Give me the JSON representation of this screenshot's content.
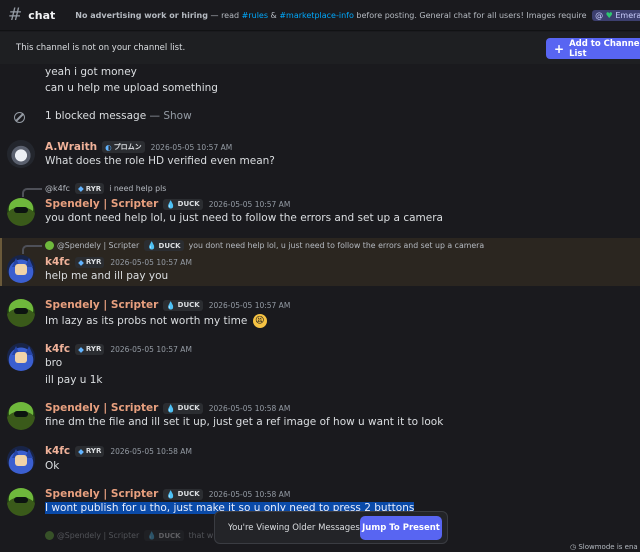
{
  "header": {
    "channel_name": "chat",
    "topic_part1": "No advertising work or hiring",
    "topic_part2": " — read ",
    "topic_rules": "#rules",
    "topic_amp": " & ",
    "topic_marketplace": "#marketplace-info",
    "topic_part3": " before posting. General chat for all users! Images require ",
    "topic_role": "@",
    "topic_role_name": "Emerald III",
    "topic_tail": "+"
  },
  "notice": {
    "text": "This channel is not on your channel list.",
    "add_button": "Add to Channel List"
  },
  "messages": {
    "m0": {
      "line1": "yeah i got money",
      "line2": "can u help me upload something"
    },
    "blocked": {
      "text": "1 blocked message",
      "dash": " — ",
      "show": "Show"
    },
    "m1": {
      "author": "A.Wraith",
      "tag": "プロムン",
      "ts": "2026-05-05 10:57 AM",
      "text": "What does the role HD verified even mean?"
    },
    "m2": {
      "reply_name": "@k4fc",
      "reply_tag": "RYR",
      "reply_text": "i need help pls",
      "author": "Spendely | Scripter",
      "tag": "DUCK",
      "ts": "2026-05-05 10:57 AM",
      "text": "you dont need help lol, u just need to follow the errors and set up a camera"
    },
    "m3": {
      "reply_name": "@Spendely | Scripter",
      "reply_tag": "DUCK",
      "reply_text": "you dont need help lol, u just need to follow the errors and set up a camera",
      "author": "k4fc",
      "tag": "RYR",
      "ts": "2026-05-05 10:57 AM",
      "text": "help me and ill pay you"
    },
    "m4": {
      "author": "Spendely | Scripter",
      "tag": "DUCK",
      "ts": "2026-05-05 10:57 AM",
      "text": "Im lazy as its probs not worth my time"
    },
    "m5": {
      "author": "k4fc",
      "tag": "RYR",
      "ts": "2026-05-05 10:57 AM",
      "line1": "bro",
      "line2": "ill pay u 1k"
    },
    "m6": {
      "author": "Spendely | Scripter",
      "tag": "DUCK",
      "ts": "2026-05-05 10:58 AM",
      "text": "fine dm the file and ill set it up, just get a ref image of how u want it to look"
    },
    "m7": {
      "author": "k4fc",
      "tag": "RYR",
      "ts": "2026-05-05 10:58 AM",
      "text": "Ok"
    },
    "m8": {
      "author": "Spendely | Scripter",
      "tag": "DUCK",
      "ts": "2026-05-05 10:58 AM",
      "text": "I wont publish for u tho, just make it so u only need to press 2 buttons"
    },
    "m9": {
      "reply_name": "@Spendely | Scripter",
      "reply_tag": "DUCK",
      "reply_text": "that wi"
    }
  },
  "footer": {
    "older_text": "You're Viewing Older Messages",
    "jump_button": "Jump To Present",
    "slowmode": "Slowmode is ena"
  }
}
